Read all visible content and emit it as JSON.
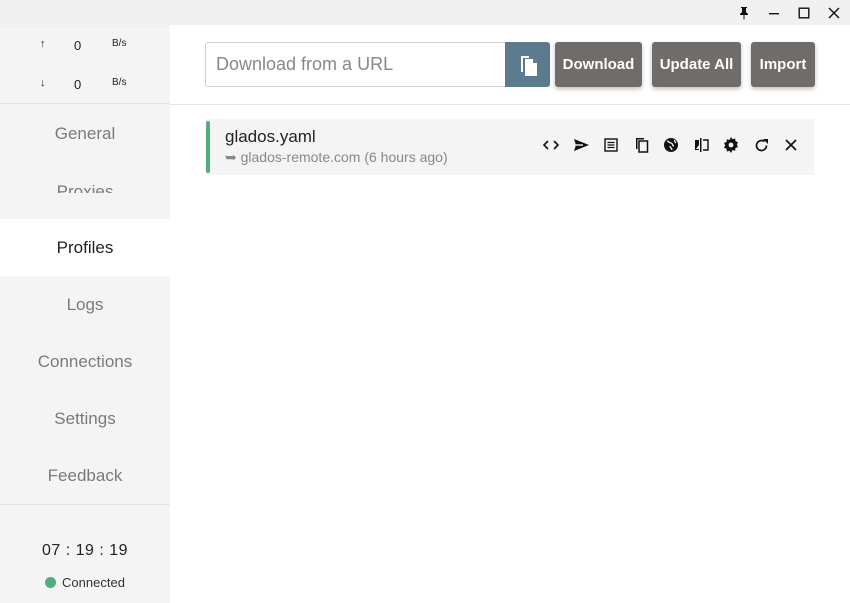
{
  "traffic": {
    "up": {
      "arrow": "↑",
      "value": "0",
      "unit": "B/s"
    },
    "down": {
      "arrow": "↓",
      "value": "0",
      "unit": "B/s"
    }
  },
  "nav": [
    {
      "label": "General"
    },
    {
      "label": "Proxies"
    },
    {
      "label": "Profiles",
      "active": true
    },
    {
      "label": "Logs"
    },
    {
      "label": "Connections"
    },
    {
      "label": "Settings"
    },
    {
      "label": "Feedback"
    }
  ],
  "clock": "07 : 19 : 19",
  "status": {
    "label": "Connected",
    "color": "#4caf7d"
  },
  "toolbar": {
    "url_placeholder": "Download from a URL",
    "download_label": "Download",
    "update_all_label": "Update All",
    "import_label": "Import"
  },
  "profile": {
    "name": "glados.yaml",
    "source": "➥ glados-remote.com (6 hours ago)",
    "accent_color": "#4caf7d",
    "actions": [
      "code-icon",
      "send-icon",
      "list-icon",
      "copy-icon",
      "globe-icon",
      "compare-icon",
      "gear-icon",
      "refresh-icon",
      "close-icon"
    ]
  },
  "colors": {
    "paste_button": "#5c7a8e",
    "gray_button": "#706c6a",
    "sidebar_bg": "#f4f4f4"
  }
}
